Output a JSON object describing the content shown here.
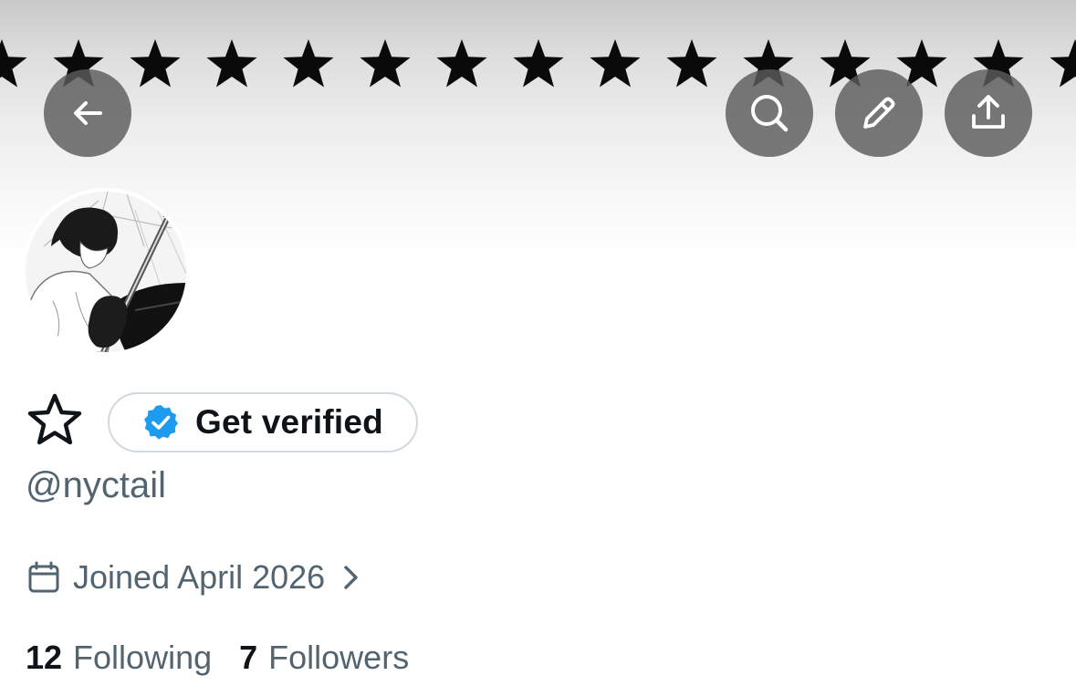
{
  "header": {
    "back_icon": "arrow-left-icon",
    "search_icon": "search-icon",
    "edit_icon": "pencil-icon",
    "share_icon": "share-upload-icon",
    "banner_pattern": "row of black stars"
  },
  "profile": {
    "display_name_icon": "star-outline-icon",
    "verify_button_label": "Get verified",
    "verify_badge_color": "#1d9bf0",
    "handle": "@nyctail",
    "joined_text": "Joined April 2026",
    "following_count": "12",
    "following_label": "Following",
    "followers_count": "7",
    "followers_label": "Followers"
  },
  "colors": {
    "text_primary": "#0f1419",
    "text_secondary": "#536471",
    "pill_border": "#cfd9de",
    "header_button_bg": "#5c5c5c"
  }
}
